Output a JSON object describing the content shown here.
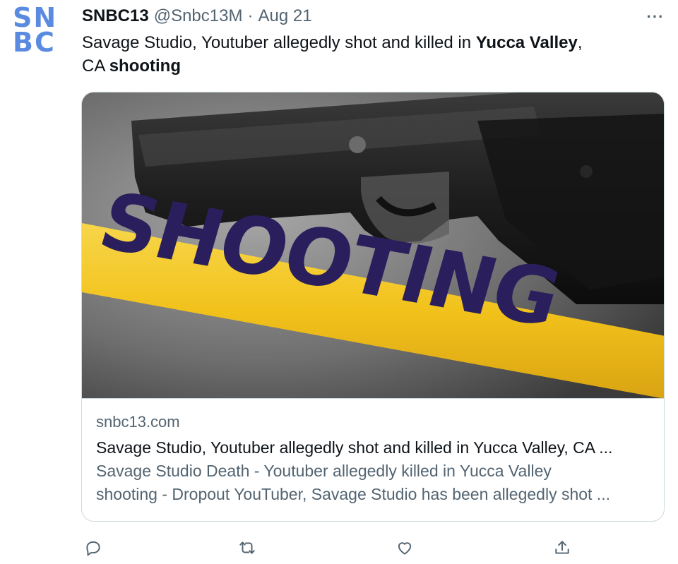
{
  "tweet": {
    "author_name": "SNBC13",
    "author_handle": "@Snbc13M",
    "separator": "·",
    "date": "Aug 21",
    "avatar_text": {
      "line1": "SN",
      "line2": "BC"
    },
    "more_label": "···",
    "text_parts": [
      {
        "text": "Savage Studio, Youtuber allegedly shot and killed in ",
        "bold": false
      },
      {
        "text": "Yucca Valley",
        "bold": true
      },
      {
        "text": ",",
        "bold": false
      },
      {
        "text": "CA ",
        "bold": false
      },
      {
        "text": "shooting",
        "bold": true
      }
    ]
  },
  "card": {
    "image_text": "SHOOTING",
    "domain": "snbc13.com",
    "title": "Savage Studio, Youtuber allegedly shot and killed in Yucca Valley, CA ...",
    "description_line1": "Savage Studio Death - Youtuber allegedly killed in  Yucca Valley",
    "description_line2": "shooting - Dropout YouTuber, Savage Studio has been allegedly shot ..."
  },
  "actions": [
    {
      "name": "reply-icon"
    },
    {
      "name": "retweet-icon"
    },
    {
      "name": "like-icon"
    },
    {
      "name": "share-icon"
    }
  ],
  "colors": {
    "accent_logo": "#5b8be0",
    "secondary_text": "#536471",
    "primary_text": "#0f1419",
    "border": "#cfd9de",
    "tape_yellow": "#f2c21b",
    "tape_text": "#2a1f5c"
  }
}
